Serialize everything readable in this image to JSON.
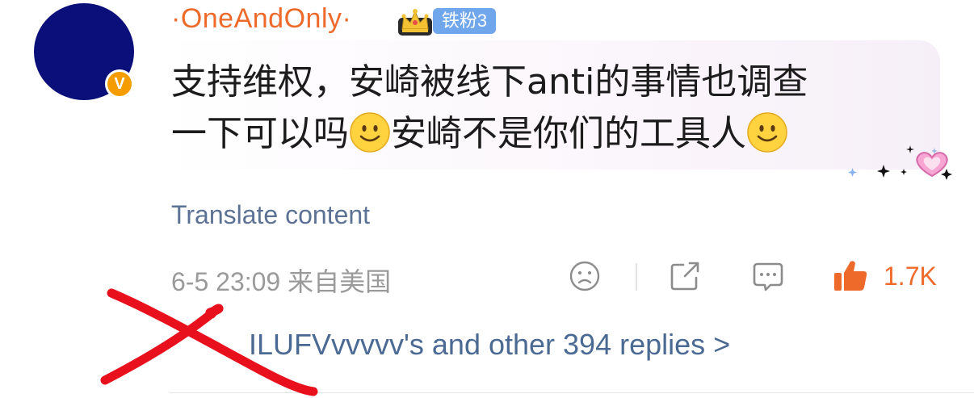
{
  "user": {
    "name": "·OneAndOnly·",
    "fan_badge": "铁粉3",
    "verified_mark": "V"
  },
  "comment": {
    "line1": "支持维权，安崎被线下anti的事情也调查",
    "line2a": "一下可以吗",
    "line2b": "安崎不是你们的工具人"
  },
  "translate_label": "Translate content",
  "meta": {
    "timestamp": "6-5 23:09 来自美国",
    "likes": "1.7K"
  },
  "replies_label": "ILUFVvvvvv's and other 394 replies >",
  "colors": {
    "username": "#ee6a2b",
    "avatar": "#0a0f7a",
    "badge": "#6fa6ec",
    "link": "#5b7295",
    "like": "#ee6a2b"
  },
  "icons": [
    "crown-icon",
    "smile-emoji-icon",
    "sad-face-icon",
    "share-icon",
    "comment-icon",
    "thumbs-up-icon",
    "heart-sparkle-icon"
  ]
}
